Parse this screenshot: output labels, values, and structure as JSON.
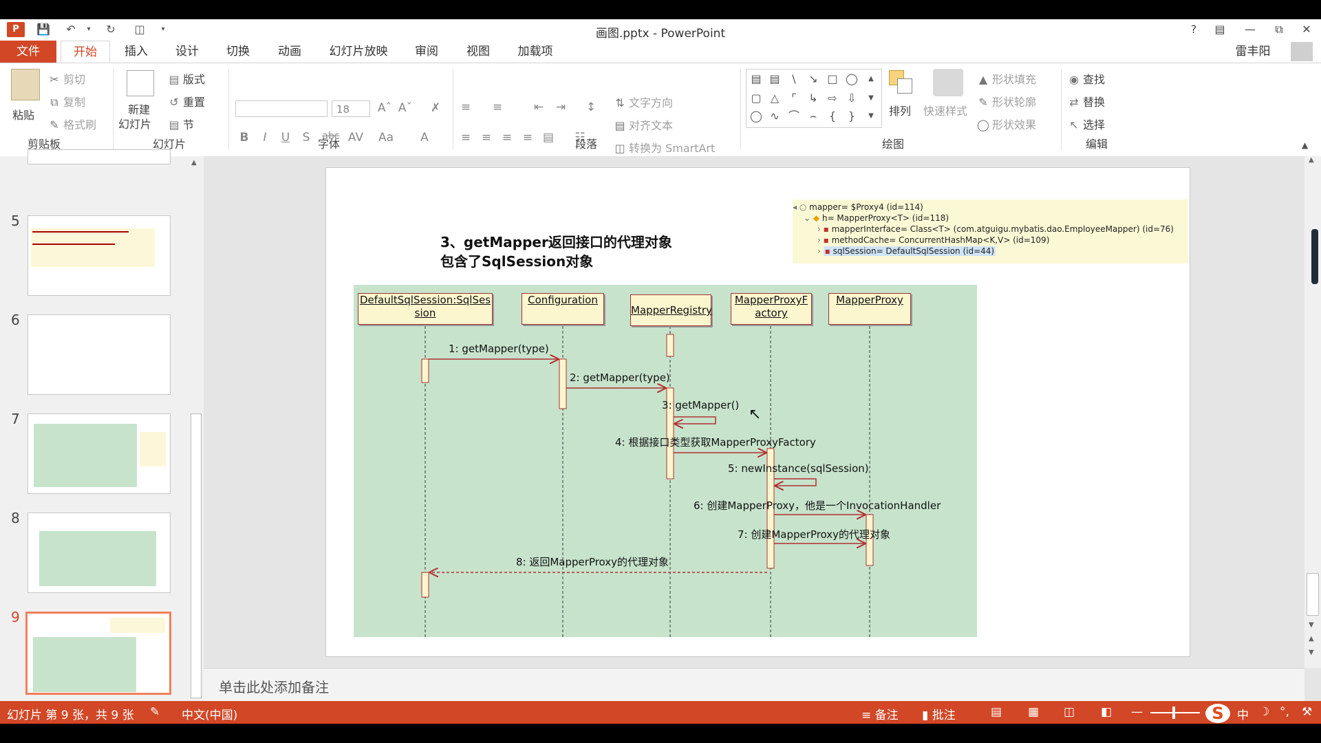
{
  "window": {
    "title": "画图.pptx - PowerPoint",
    "help": "?",
    "user": "雷丰阳"
  },
  "tabs": [
    "文件",
    "开始",
    "插入",
    "设计",
    "切换",
    "动画",
    "幻灯片放映",
    "审阅",
    "视图",
    "加载项"
  ],
  "ribbon": {
    "clipboard": {
      "label": "剪贴板",
      "paste": "粘贴",
      "cut": "剪切",
      "copy": "复制",
      "format_painter": "格式刷"
    },
    "slides": {
      "label": "幻灯片",
      "new_slide_1": "新建",
      "new_slide_2": "幻灯片",
      "layout": "版式",
      "reset": "重置",
      "section": "节"
    },
    "font": {
      "label": "字体",
      "font_name": "",
      "font_size": "18",
      "bold": "B",
      "italic": "I",
      "underline": "U",
      "shadow": "S",
      "strike": "abc",
      "spacing": "AV",
      "case": "Aa",
      "color": "A"
    },
    "paragraph": {
      "label": "段落",
      "text_direction": "文字方向",
      "align_text": "对齐文本",
      "convert_smartart": "转换为 SmartArt"
    },
    "drawing": {
      "label": "绘图",
      "arrange": "排列",
      "quick_styles": "快速样式",
      "shape_fill": "形状填充",
      "shape_outline": "形状轮廓",
      "shape_effects": "形状效果"
    },
    "editing": {
      "label": "编辑",
      "find": "查找",
      "replace": "替换",
      "select": "选择"
    }
  },
  "thumbnails": [
    {
      "num": "5"
    },
    {
      "num": "6"
    },
    {
      "num": "7"
    },
    {
      "num": "8"
    },
    {
      "num": "9"
    }
  ],
  "slide": {
    "title_line1": "3、getMapper返回接口的代理对象",
    "title_line2": "包含了SqlSession对象",
    "debug": [
      "mapper= $Proxy4  (id=114)",
      "h= MapperProxy<T>  (id=118)",
      "mapperInterface= Class<T> (com.atguigu.mybatis.dao.EmployeeMapper) (id=76)",
      "methodCache= ConcurrentHashMap<K,V>  (id=109)",
      "sqlSession= DefaultSqlSession  (id=44)"
    ],
    "lifelines": [
      "DefaultSqlSession:SqlSes sion",
      "Configuration",
      "MapperRegistry",
      "MapperProxyF actory",
      "MapperProxy"
    ],
    "messages": [
      "1: getMapper(type)",
      "2: getMapper(type)",
      "3: getMapper()",
      "4: 根据接口类型获取MapperProxyFactory",
      "5: newInstance(sqlSession)",
      "6: 创建MapperProxy，他是一个InvocationHandler",
      "7: 创建MapperProxy的代理对象",
      "8: 返回MapperProxy的代理对象"
    ]
  },
  "notes_placeholder": "单击此处添加备注",
  "status": {
    "slide_info": "幻灯片 第 9 张，共 9 张",
    "language": "中文(中国)",
    "notes": "备注",
    "comments": "批注",
    "ime": "中"
  }
}
